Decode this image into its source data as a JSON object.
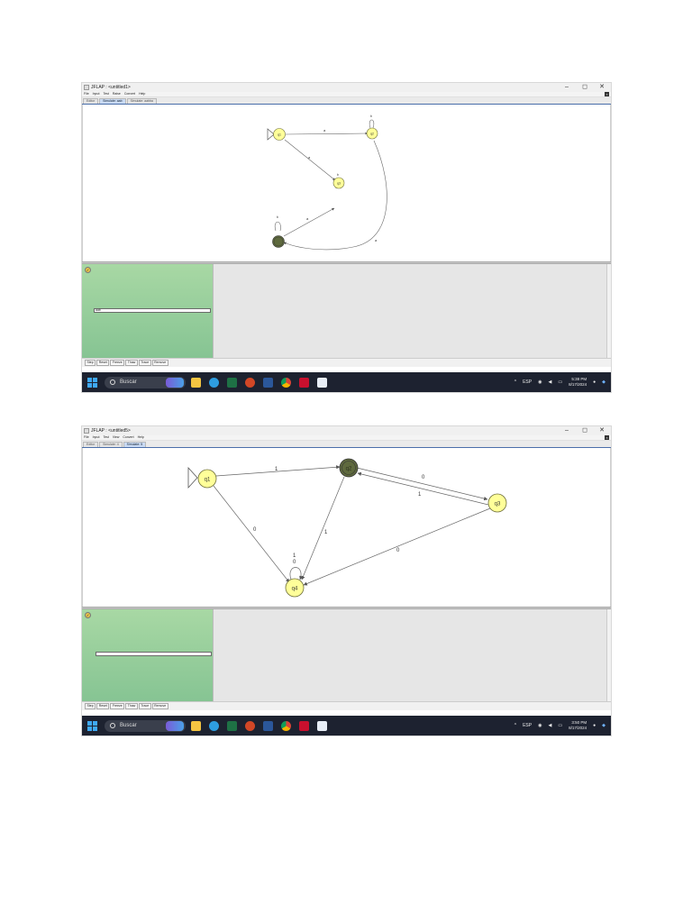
{
  "shots": [
    {
      "window_title": "JFLAP : <untitled1>",
      "menu": [
        "File",
        "Input",
        "Test",
        "Raise",
        "Convert",
        "Help"
      ],
      "tabs": [
        "Editor",
        "Simulate: aab",
        "Simulate: aabba"
      ],
      "states": [
        "q1",
        "q2",
        "q3",
        "q4"
      ],
      "transitions": [
        "a",
        "a",
        "a",
        "a",
        "b",
        "b",
        "b"
      ],
      "input_value": "aab",
      "buttons": [
        "Step",
        "Reset",
        "Freeze",
        "Thaw",
        "Trace",
        "Remove"
      ],
      "taskbar": {
        "search": "Buscar",
        "lang": "ESP",
        "time": "5:38 PM",
        "date": "8/17/2024"
      }
    },
    {
      "window_title": "JFLAP : <untitled5>",
      "menu": [
        "File",
        "Input",
        "Test",
        "View",
        "Convert",
        "Help"
      ],
      "tabs": [
        "Editor",
        "Simulate: 4",
        "Simulate: 5"
      ],
      "states": [
        "q1",
        "q2",
        "q3",
        "q4"
      ],
      "transitions": [
        "1",
        "0",
        "1",
        "0",
        "1",
        "0",
        "0",
        "1"
      ],
      "input_value": "",
      "buttons": [
        "Step",
        "Reset",
        "Freeze",
        "Thaw",
        "Trace",
        "Remove"
      ],
      "taskbar": {
        "search": "Buscar",
        "lang": "ESP",
        "time": "3:50 PM",
        "date": "8/17/2024"
      }
    }
  ],
  "window_controls": [
    "–",
    "◻",
    "✕"
  ],
  "colors": {
    "state_fill": "#ffff99",
    "accepting_fill": "#5f6a3e",
    "green_top": "#a8d8a4",
    "green_bottom": "#86c493",
    "taskbar": "#1d2230"
  },
  "icons": [
    "windows-start-icon",
    "search-icon",
    "file-explorer-icon",
    "edge-icon",
    "excel-icon",
    "powerpoint-icon",
    "word-icon",
    "chrome-icon",
    "pdf-icon",
    "java-icon",
    "wifi-icon",
    "volume-icon",
    "battery-icon",
    "notification-icon"
  ]
}
